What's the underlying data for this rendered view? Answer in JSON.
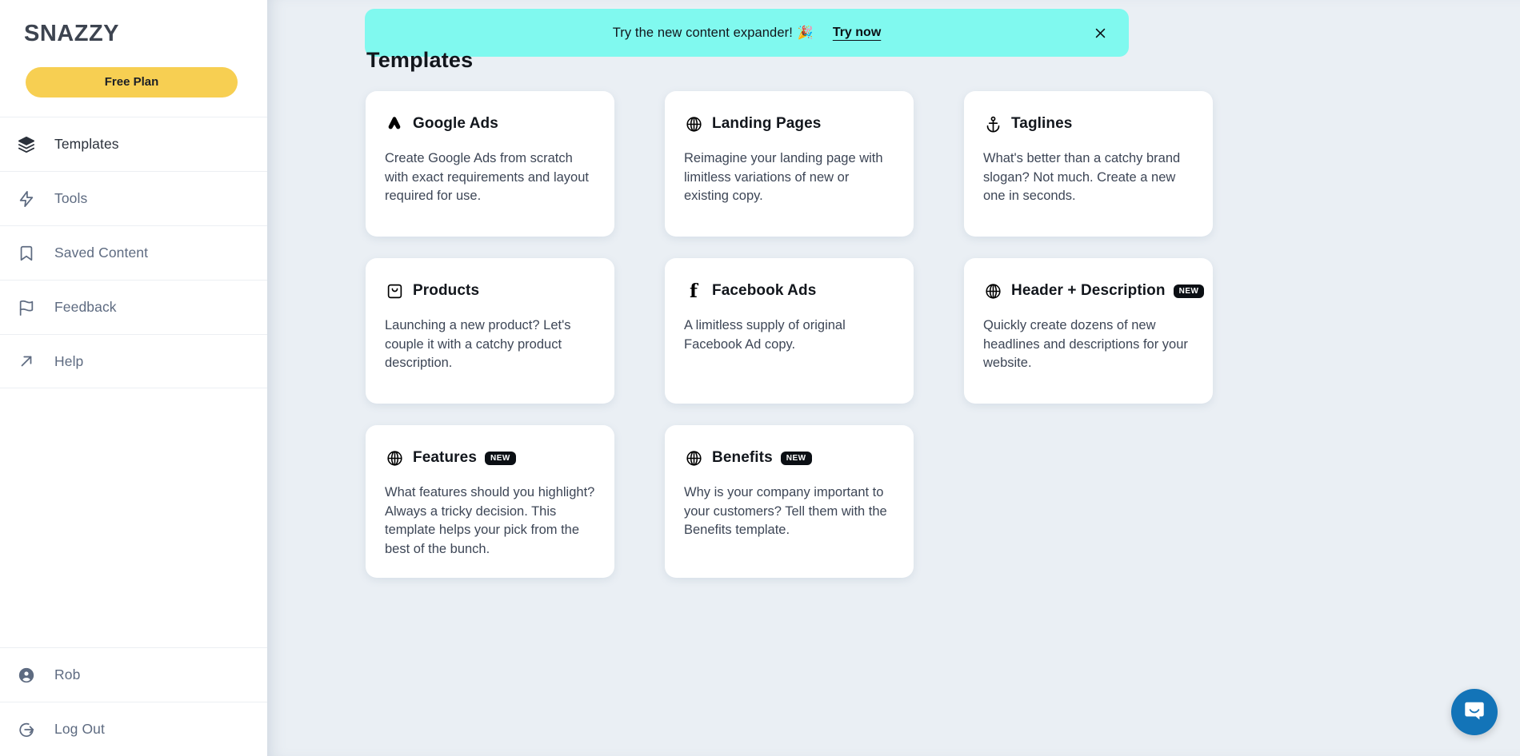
{
  "sidebar": {
    "brand": "SNAZZY",
    "plan_button": "Free Plan",
    "items": [
      {
        "label": "Templates",
        "icon": "layers-icon"
      },
      {
        "label": "Tools",
        "icon": "bolt-icon"
      },
      {
        "label": "Saved Content",
        "icon": "bookmark-icon"
      },
      {
        "label": "Feedback",
        "icon": "flag-icon"
      },
      {
        "label": "Help",
        "icon": "arrow-up-right-icon"
      }
    ],
    "bottom_items": [
      {
        "label": "Rob",
        "icon": "user-circle-icon"
      },
      {
        "label": "Log Out",
        "icon": "logout-icon"
      }
    ]
  },
  "banner": {
    "text": "Try the new content expander!",
    "emoji": "🎉",
    "cta": "Try now",
    "close_icon": "close-icon",
    "background": "#80f9ef"
  },
  "main": {
    "title": "Templates"
  },
  "cards": [
    {
      "title": "Google Ads",
      "icon": "google-ads-icon",
      "badge": "",
      "description": "Create Google Ads from scratch with exact requirements and layout required for use."
    },
    {
      "title": "Landing Pages",
      "icon": "globe-icon",
      "badge": "",
      "description": "Reimagine your landing page with limitless variations of new or existing copy."
    },
    {
      "title": "Taglines",
      "icon": "anchor-icon",
      "badge": "",
      "description": "What's better than a catchy brand slogan? Not much. Create a new one in seconds."
    },
    {
      "title": "Products",
      "icon": "shopping-bag-icon",
      "badge": "",
      "description": "Launching a new product? Let's couple it with a catchy product description."
    },
    {
      "title": "Facebook Ads",
      "icon": "facebook-icon",
      "badge": "",
      "description": "A limitless supply of original Facebook Ad copy."
    },
    {
      "title": "Header + Description",
      "icon": "globe-icon",
      "badge": "NEW",
      "description": "Quickly create dozens of new headlines and descriptions for your website."
    },
    {
      "title": "Features",
      "icon": "globe-icon",
      "badge": "NEW",
      "description": "What features should you highlight? Always a tricky decision. This template helps your pick from the best of the bunch."
    },
    {
      "title": "Benefits",
      "icon": "globe-icon",
      "badge": "NEW",
      "description": "Why is your company important to your customers? Tell them with the Benefits template."
    }
  ],
  "chat_widget": {
    "icon": "chat-bubble-icon",
    "color": "#1374b8"
  }
}
